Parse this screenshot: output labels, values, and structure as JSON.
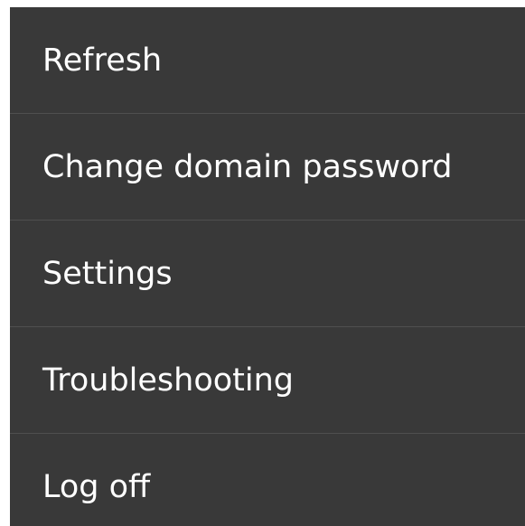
{
  "menu": {
    "items": [
      {
        "label": "Refresh"
      },
      {
        "label": "Change domain password"
      },
      {
        "label": "Settings"
      },
      {
        "label": "Troubleshooting"
      },
      {
        "label": "Log off"
      }
    ]
  },
  "colors": {
    "menu_background": "#393939",
    "divider": "#4f4f4f",
    "text": "#ffffff",
    "page_background": "#ffffff"
  }
}
